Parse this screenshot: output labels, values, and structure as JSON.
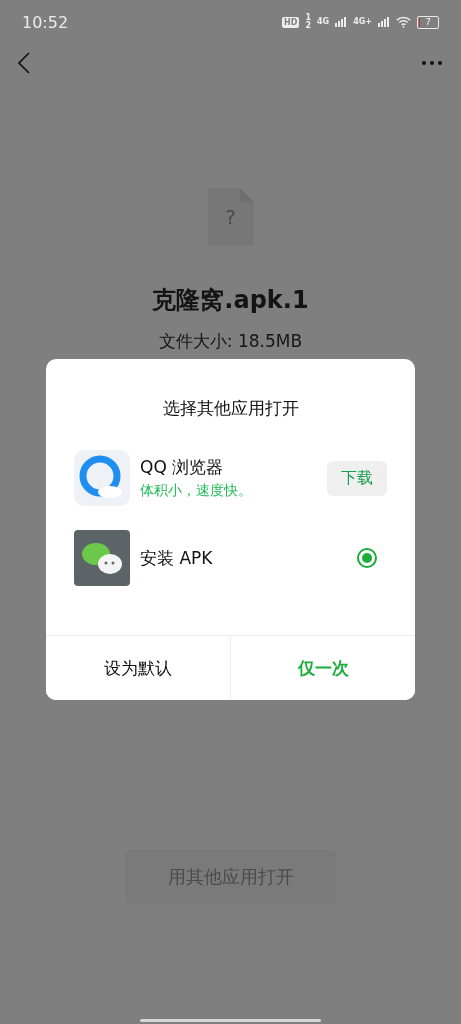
{
  "status_bar": {
    "time": "10:52",
    "hd": "HD",
    "sim_slots": [
      "1",
      "2"
    ],
    "networks": [
      "4G",
      "4G+"
    ],
    "battery": "7",
    "level": 0.07
  },
  "file": {
    "name": "克隆窝.apk.1",
    "size": "文件大小: 18.5MB",
    "icon_glyph": "?"
  },
  "open_button": "用其他应用打开",
  "dialog": {
    "title": "选择其他应用打开",
    "apps": [
      {
        "kind": "download",
        "name": "QQ 浏览器",
        "tagline": "体积小，速度快。",
        "action": "下载"
      },
      {
        "kind": "radio",
        "name": "安装 APK",
        "selected": true
      }
    ],
    "buttons": [
      {
        "label": "设为默认",
        "primary": false
      },
      {
        "label": "仅一次",
        "primary": true
      }
    ]
  }
}
